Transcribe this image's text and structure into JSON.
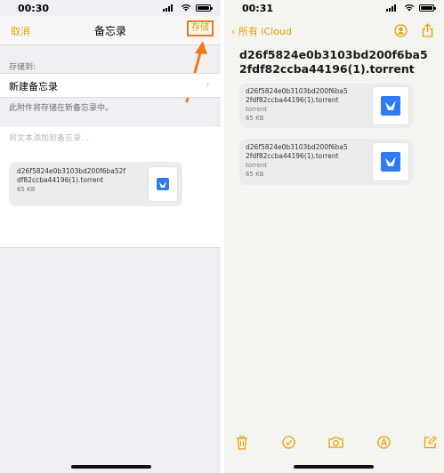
{
  "left": {
    "status": {
      "time": "00:30"
    },
    "nav": {
      "cancel": "取消",
      "title": "备忘录",
      "save": "存储"
    },
    "save_to_label": "存储到:",
    "new_note_row": "新建备忘录",
    "footnote": "此附件将存储在新备忘录中。",
    "placeholder": "将文本添加到备忘录…",
    "attachment": {
      "name_line1": "d26f5824e0b3103bd200f6ba52f",
      "name_line2": "df82ccba44196(1).torrent",
      "size": "65 KB"
    }
  },
  "right": {
    "status": {
      "time": "00:31"
    },
    "back_label": "所有 iCloud",
    "title_line1": "d26f5824e0b3103bd200f6ba5",
    "title_line2": "2fdf82ccba44196(1).torrent",
    "attachments": [
      {
        "name_line1": "d26f5824e0b3103bd200f6ba5",
        "name_line2": "2fdf82ccba44196(1).torrent",
        "type": "torrent",
        "size": "65 KB"
      },
      {
        "name_line1": "d26f5824e0b3103bd200f6ba5",
        "name_line2": "2fdf82ccba44196(1).torrent",
        "type": "torrent",
        "size": "65 KB"
      }
    ],
    "toolbar_icons": [
      "trash-icon",
      "checklist-icon",
      "camera-icon",
      "markup-icon",
      "compose-icon"
    ]
  },
  "colors": {
    "accent": "#e6a000",
    "highlight": "#f07a1a",
    "app_icon_blue": "#2f7bf5"
  }
}
